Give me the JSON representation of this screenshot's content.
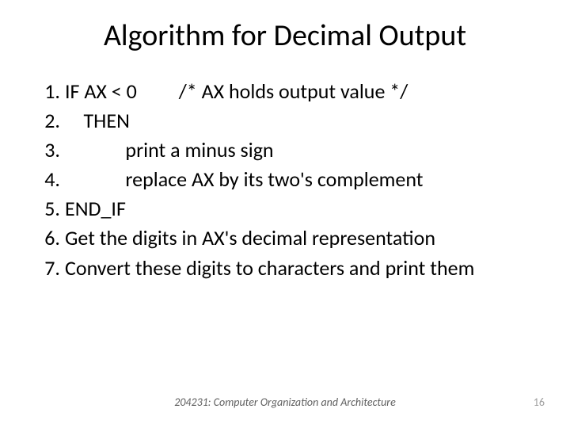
{
  "title": "Algorithm for Decimal Output",
  "items": [
    {
      "n": "1.",
      "t": "IF AX < 0         /* AX holds output value */"
    },
    {
      "n": "2.",
      "t": "    THEN"
    },
    {
      "n": "3.",
      "t": "             print a minus sign"
    },
    {
      "n": "4.",
      "t": "             replace AX by its two's complement"
    },
    {
      "n": "5.",
      "t": "END_IF"
    },
    {
      "n": "6.",
      "t": "Get the digits in AX's decimal representation"
    },
    {
      "n": "7.",
      "t": "Convert these digits to characters and print them"
    }
  ],
  "footer": "204231: Computer Organization and Architecture",
  "pagenum": "16"
}
